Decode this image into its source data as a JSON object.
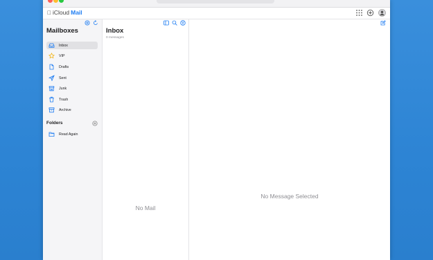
{
  "colors": {
    "desktop": "#2f86d6",
    "accent": "#1d7cf2",
    "sidebar_bg": "#f5f5f7",
    "selected_bg": "#e1e1e4",
    "muted_text": "#8e8e93"
  },
  "header": {
    "brand_prefix": "iCloud",
    "brand_app": "Mail",
    "icons": [
      "apps-grid-icon",
      "add-circle-icon",
      "account-avatar-icon"
    ]
  },
  "sidebar": {
    "title": "Mailboxes",
    "top_icons": [
      "settings-icon",
      "refresh-icon"
    ],
    "mailboxes": [
      {
        "label": "Inbox",
        "icon": "inbox-icon",
        "selected": true
      },
      {
        "label": "VIP",
        "icon": "star-icon",
        "selected": false
      },
      {
        "label": "Drafts",
        "icon": "draft-icon",
        "selected": false
      },
      {
        "label": "Sent",
        "icon": "sent-icon",
        "selected": false
      },
      {
        "label": "Junk",
        "icon": "junk-icon",
        "selected": false
      },
      {
        "label": "Trash",
        "icon": "trash-icon",
        "selected": false
      },
      {
        "label": "Archive",
        "icon": "archive-icon",
        "selected": false
      }
    ],
    "folders_title": "Folders",
    "folders": [
      {
        "label": "Read Again",
        "icon": "folder-icon"
      }
    ]
  },
  "list": {
    "title": "Inbox",
    "subtitle": "0 messages",
    "icons": [
      "toggle-sidebar-icon",
      "search-icon",
      "filter-icon"
    ],
    "empty_text": "No Mail"
  },
  "reader": {
    "empty_text": "No Message Selected",
    "compose_icon": "compose-icon"
  }
}
